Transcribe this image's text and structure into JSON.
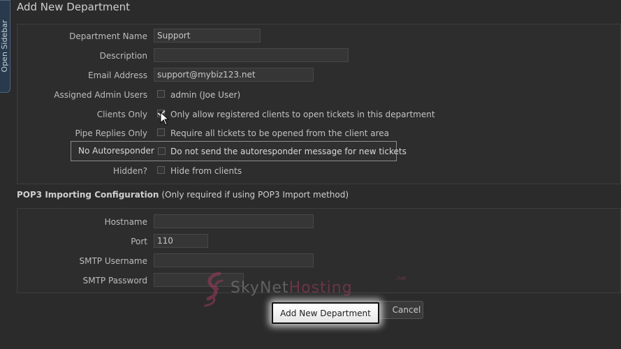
{
  "sidebar": {
    "label": "Open Sidebar"
  },
  "page_title": "Add New Department",
  "department": {
    "name_label": "Department Name",
    "name_value": "Support",
    "description_label": "Description",
    "description_value": "",
    "email_label": "Email Address",
    "email_value": "support@mybiz123.net",
    "admins_label": "Assigned Admin Users",
    "admins_option": "admin (Joe User)",
    "clients_only_label": "Clients Only",
    "clients_only_text": "Only allow registered clients to open tickets in this department",
    "clients_only_checked": true,
    "pipe_replies_label": "Pipe Replies Only",
    "pipe_replies_text": "Require all tickets to be opened from the client area",
    "no_autoresponder_label": "No Autoresponder",
    "no_autoresponder_text": "Do not send the autoresponder message for new tickets",
    "hidden_label": "Hidden?",
    "hidden_text": "Hide from clients"
  },
  "pop3": {
    "heading": "POP3 Importing Configuration",
    "heading_note": "(Only required if using POP3 Import method)",
    "hostname_label": "Hostname",
    "hostname_value": "",
    "port_label": "Port",
    "port_value": "110",
    "smtp_username_label": "SMTP Username",
    "smtp_username_value": "",
    "smtp_password_label": "SMTP Password",
    "smtp_password_value": ""
  },
  "actions": {
    "submit_label": "Add New Department",
    "cancel_label": "Cancel"
  },
  "watermark": {
    "text_a": "SkyNet",
    "text_b": "Hosting",
    "suffix": ".net"
  }
}
